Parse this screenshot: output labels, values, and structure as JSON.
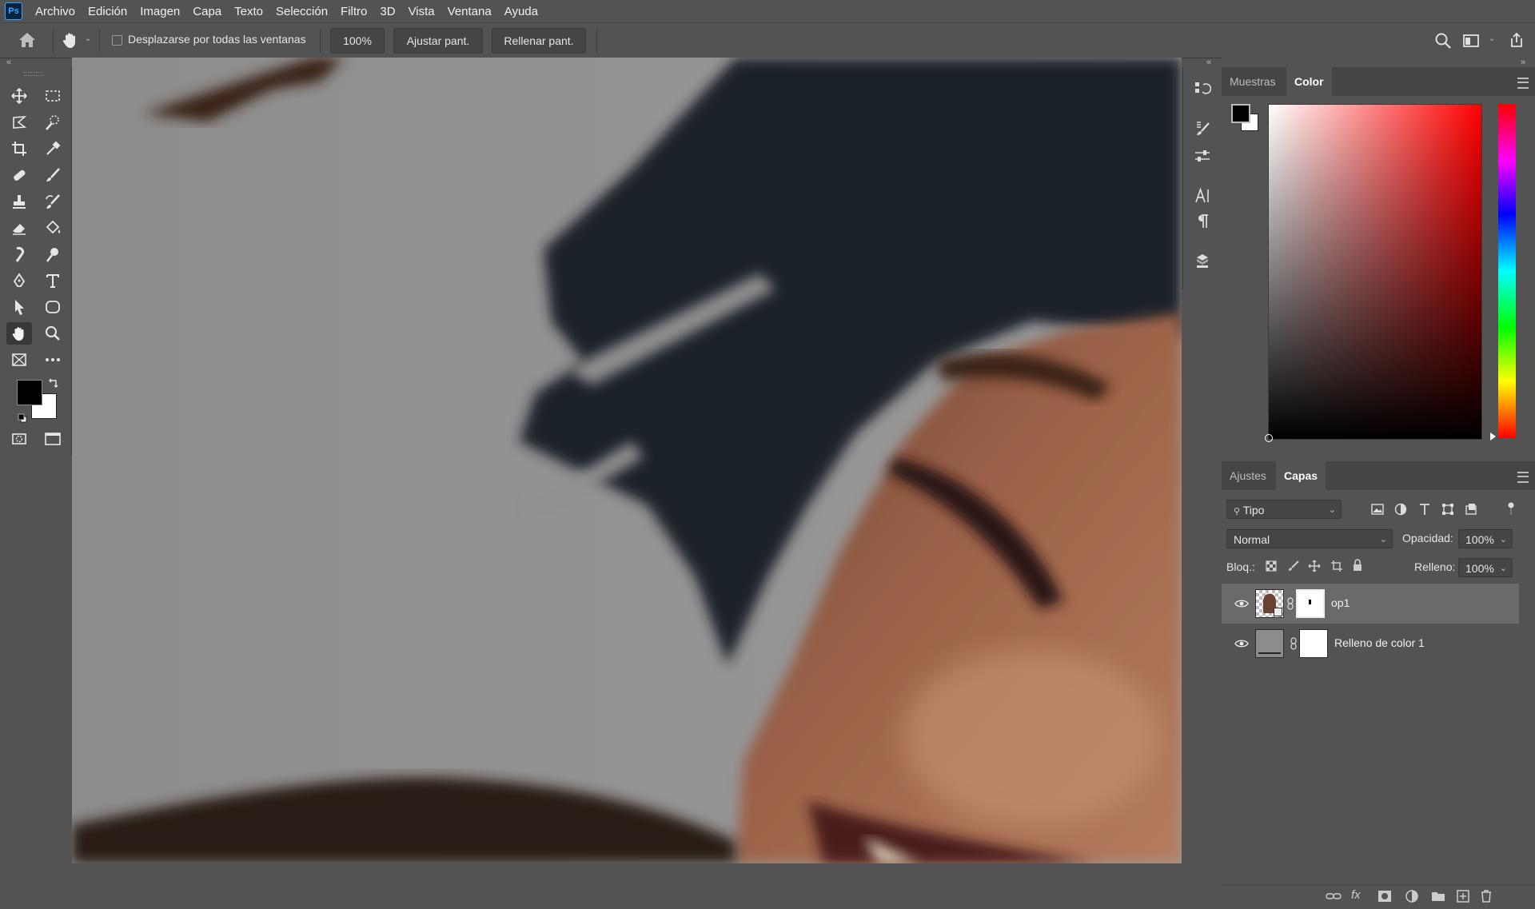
{
  "app": {
    "logo": "Ps"
  },
  "menu": [
    "Archivo",
    "Edición",
    "Imagen",
    "Capa",
    "Texto",
    "Selección",
    "Filtro",
    "3D",
    "Vista",
    "Ventana",
    "Ayuda"
  ],
  "options": {
    "scroll_all_label": "Desplazarse por todas las ventanas",
    "zoom": "100%",
    "fit_screen": "Ajustar pant.",
    "fill_screen": "Rellenar pant."
  },
  "color_panel": {
    "tabs": [
      "Muestras",
      "Color"
    ],
    "active_tab": "Color",
    "foreground": "#000000",
    "background": "#ffffff",
    "hue_base": "#ff0000"
  },
  "layers_panel": {
    "tabs": [
      "Ajustes",
      "Capas"
    ],
    "active_tab": "Capas",
    "filter": "Tipo",
    "blend_mode": "Normal",
    "opacity_label": "Opacidad:",
    "opacity": "100%",
    "lock_label": "Bloq.:",
    "fill_label": "Relleno:",
    "fill": "100%",
    "layers": [
      {
        "name": "op1",
        "selected": true,
        "visible": true
      },
      {
        "name": "Relleno de color 1",
        "selected": false,
        "visible": true
      }
    ]
  }
}
